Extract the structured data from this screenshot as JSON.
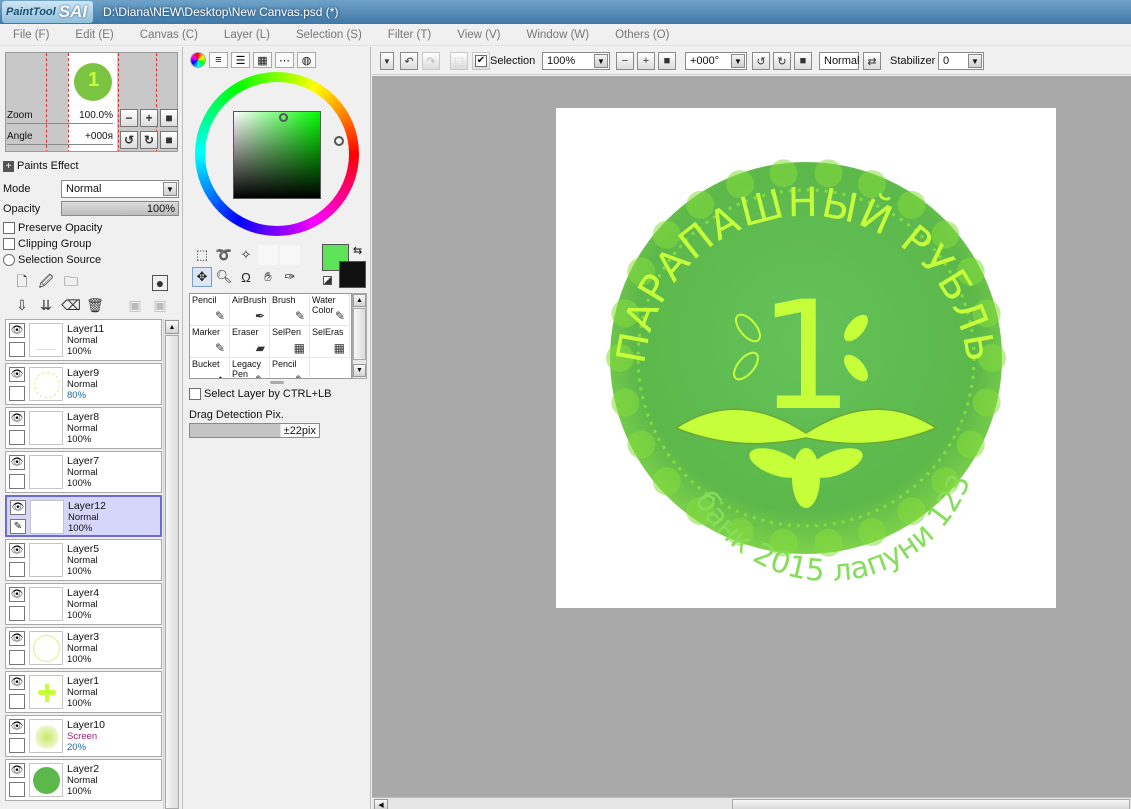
{
  "app": {
    "logo_small": "PaintTool",
    "logo_big": "SAI",
    "window_title": "D:\\Diana\\NEW\\Desktop\\New Canvas.psd (*)"
  },
  "menu": [
    {
      "label": "File (F)"
    },
    {
      "label": "Edit (E)"
    },
    {
      "label": "Canvas (C)"
    },
    {
      "label": "Layer (L)"
    },
    {
      "label": "Selection (S)"
    },
    {
      "label": "Filter (T)"
    },
    {
      "label": "View (V)"
    },
    {
      "label": "Window (W)"
    },
    {
      "label": "Others (O)"
    }
  ],
  "navigator": {
    "zoom_label": "Zoom",
    "zoom_value": "100.0%",
    "angle_label": "Angle",
    "angle_value": "+000я"
  },
  "layer_props": {
    "paints_effect": "Paints Effect",
    "mode_label": "Mode",
    "mode_value": "Normal",
    "opacity_label": "Opacity",
    "opacity_value": "100%",
    "preserve_opacity": "Preserve Opacity",
    "clipping_group": "Clipping Group",
    "selection_source": "Selection Source"
  },
  "layers": [
    {
      "name": "Layer11",
      "mode": "Normal",
      "opacity": "100%",
      "selected": false,
      "thumb": "line"
    },
    {
      "name": "Layer9",
      "mode": "Normal",
      "opacity": "80%",
      "selected": false,
      "thumb": "arc"
    },
    {
      "name": "Layer8",
      "mode": "Normal",
      "opacity": "100%",
      "selected": false,
      "thumb": "blank"
    },
    {
      "name": "Layer7",
      "mode": "Normal",
      "opacity": "100%",
      "selected": false,
      "thumb": "blank"
    },
    {
      "name": "Layer12",
      "mode": "Normal",
      "opacity": "100%",
      "selected": true,
      "thumb": "blank"
    },
    {
      "name": "Layer5",
      "mode": "Normal",
      "opacity": "100%",
      "selected": false,
      "thumb": "blank"
    },
    {
      "name": "Layer4",
      "mode": "Normal",
      "opacity": "100%",
      "selected": false,
      "thumb": "blank"
    },
    {
      "name": "Layer3",
      "mode": "Normal",
      "opacity": "100%",
      "selected": false,
      "thumb": "ring"
    },
    {
      "name": "Layer1",
      "mode": "Normal",
      "opacity": "100%",
      "selected": false,
      "thumb": "leaf"
    },
    {
      "name": "Layer10",
      "mode": "Screen",
      "opacity": "20%",
      "selected": false,
      "thumb": "blur"
    },
    {
      "name": "Layer2",
      "mode": "Normal",
      "opacity": "100%",
      "selected": false,
      "thumb": "disc"
    }
  ],
  "brushes": [
    {
      "label": "Pencil",
      "icon": "✎"
    },
    {
      "label": "AirBrush",
      "icon": "✒"
    },
    {
      "label": "Brush",
      "icon": "✎"
    },
    {
      "label": "Water Color",
      "icon": "✎"
    },
    {
      "label": "Marker",
      "icon": "✎"
    },
    {
      "label": "Eraser",
      "icon": "▰"
    },
    {
      "label": "SelPen",
      "icon": "▦"
    },
    {
      "label": "SelEras",
      "icon": "▦"
    },
    {
      "label": "Bucket",
      "icon": "◆"
    },
    {
      "label": "Legacy Pen",
      "icon": "✎"
    },
    {
      "label": "Pencil",
      "icon": "✎"
    }
  ],
  "tool_options": {
    "select_layer": "Select Layer by CTRL+LB",
    "drag_detection_label": "Drag Detection Pix.",
    "drag_detection_value": "±22pix"
  },
  "toolbar": {
    "selection_label": "Selection",
    "zoom_value": "100%",
    "angle_value": "+000°",
    "blend_value": "Normal",
    "stabilizer_label": "Stabilizer",
    "stabilizer_value": "0"
  },
  "colors": {
    "foreground": "#5de25a",
    "background": "#111111",
    "coin_outer": "#5cb84a",
    "coin_text": "#c8ff3a"
  },
  "artwork": {
    "top_text": "ПАРАПАШНЫЙ РУБЛЬ",
    "denomination": "1",
    "bottom_text": "банк 2015 лапуни 123"
  }
}
